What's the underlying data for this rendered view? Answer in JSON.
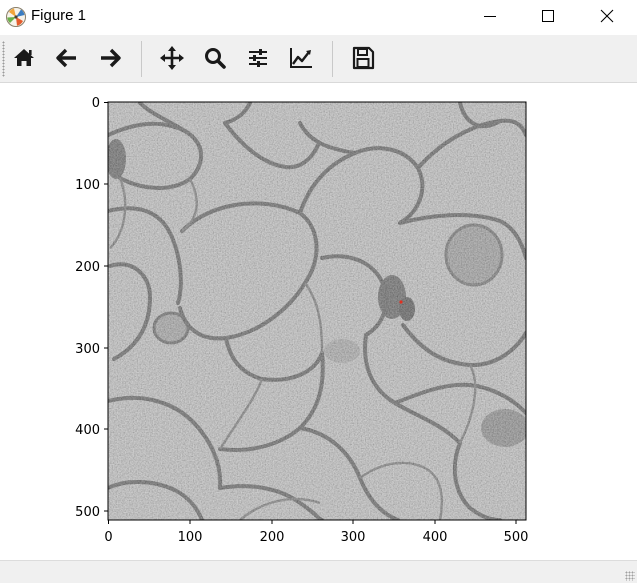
{
  "window": {
    "title": "Figure 1",
    "app_icon": "matplotlib-icon",
    "controls": [
      "minimize-icon",
      "maximize-icon",
      "close-icon"
    ]
  },
  "toolbar": {
    "buttons": [
      {
        "name": "home",
        "icon": "home-icon"
      },
      {
        "name": "back",
        "icon": "arrow-left-icon"
      },
      {
        "name": "forward",
        "icon": "arrow-right-icon"
      },
      {
        "name": "pan",
        "icon": "move-icon"
      },
      {
        "name": "zoom",
        "icon": "magnifier-icon"
      },
      {
        "name": "subplots",
        "icon": "sliders-icon"
      },
      {
        "name": "edit-axes",
        "icon": "chart-line-icon"
      },
      {
        "name": "save",
        "icon": "floppy-disk-icon"
      }
    ]
  },
  "figure": {
    "image": "grayscale electron microscopy image of cell membranes",
    "x_ticks": [
      "0",
      "100",
      "200",
      "300",
      "400",
      "500"
    ],
    "y_ticks": [
      "0",
      "100",
      "200",
      "300",
      "400",
      "500"
    ],
    "x_range": [
      0,
      511
    ],
    "y_range": [
      0,
      511
    ],
    "highlight_color": "#e03020"
  }
}
